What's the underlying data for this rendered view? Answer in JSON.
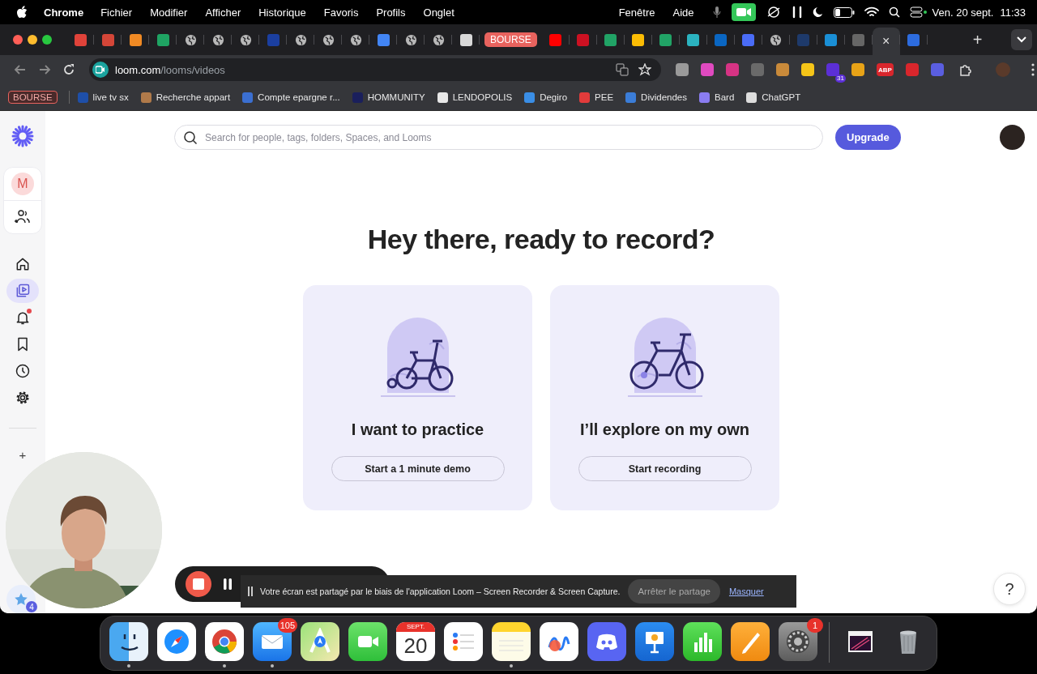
{
  "menu_bar": {
    "app": "Chrome",
    "menus": [
      "Fichier",
      "Modifier",
      "Afficher",
      "Historique",
      "Favoris",
      "Profils",
      "Onglet"
    ],
    "right_menus": [
      "Fenêtre",
      "Aide"
    ],
    "date": "Ven. 20 sept.",
    "time": "11:33"
  },
  "tabs": [
    {
      "kind": "favicon",
      "color": "#e0433a",
      "selected": false
    },
    {
      "kind": "favicon",
      "color": "#d44638",
      "selected": false
    },
    {
      "kind": "favicon",
      "color": "#f08a24",
      "selected": false
    },
    {
      "kind": "favicon",
      "color": "#1fa463",
      "selected": false
    },
    {
      "kind": "globe",
      "selected": false
    },
    {
      "kind": "globe",
      "selected": false
    },
    {
      "kind": "globe",
      "selected": false
    },
    {
      "kind": "favicon",
      "color": "#1b3fa0",
      "selected": false
    },
    {
      "kind": "globe",
      "selected": false
    },
    {
      "kind": "globe",
      "selected": false
    },
    {
      "kind": "globe",
      "selected": false
    },
    {
      "kind": "favicon",
      "color": "#4285f4",
      "selected": false
    },
    {
      "kind": "globe",
      "selected": false
    },
    {
      "kind": "globe",
      "selected": false
    },
    {
      "kind": "favicon",
      "color": "#d8d8d8",
      "selected": false
    },
    {
      "kind": "group",
      "label": "BOURSE"
    },
    {
      "kind": "favicon",
      "color": "#ff0000",
      "selected": false
    },
    {
      "kind": "favicon",
      "color": "#cc1122",
      "selected": false
    },
    {
      "kind": "favicon",
      "color": "#21a366",
      "selected": false
    },
    {
      "kind": "favicon",
      "color": "#fbbc04",
      "selected": false
    },
    {
      "kind": "favicon",
      "color": "#21a366",
      "selected": false
    },
    {
      "kind": "favicon",
      "color": "#2bb3c0",
      "selected": false
    },
    {
      "kind": "favicon",
      "color": "#0a66c2",
      "selected": false
    },
    {
      "kind": "favicon",
      "color": "#4a6cf7",
      "selected": false
    },
    {
      "kind": "globe",
      "selected": false
    },
    {
      "kind": "favicon",
      "color": "#1e3a6b",
      "selected": false
    },
    {
      "kind": "favicon",
      "color": "#1a8fd6",
      "selected": false
    },
    {
      "kind": "favicon",
      "color": "#666666",
      "selected": false
    },
    {
      "kind": "active",
      "close": "×",
      "selected": true
    },
    {
      "kind": "favicon",
      "color": "#2d6cdf",
      "selected": false
    }
  ],
  "new_tab": "+",
  "address_bar": {
    "host": "loom.com",
    "path": "/looms/videos"
  },
  "extensions": [
    {
      "color": "#9a9a9a"
    },
    {
      "color": "#e04ac0"
    },
    {
      "color": "#d63384"
    },
    {
      "color": "#6a6a6a"
    },
    {
      "color": "#c98a3a"
    },
    {
      "color": "#f5c518"
    },
    {
      "color": "#5b2fd6",
      "badge": "31"
    },
    {
      "color": "#e8a317"
    },
    {
      "color": "#d9262c",
      "label": "ABP"
    },
    {
      "color": "#d9262c"
    },
    {
      "color": "#5a5ee0"
    }
  ],
  "bookmarks": [
    {
      "kind": "group",
      "label": "BOURSE"
    },
    {
      "kind": "link",
      "label": "live tv sx",
      "color": "#1e4fa8"
    },
    {
      "kind": "link",
      "label": "Recherche appart",
      "color": "#b07a4a"
    },
    {
      "kind": "link",
      "label": "Compte epargne r...",
      "color": "#3b6fd1"
    },
    {
      "kind": "link",
      "label": "HOMMUNITY",
      "color": "#1a1f5c"
    },
    {
      "kind": "link",
      "label": "LENDOPOLIS",
      "color": "#e8e8e8"
    },
    {
      "kind": "link",
      "label": "Degiro",
      "color": "#3a8ee6"
    },
    {
      "kind": "link",
      "label": "PEE",
      "color": "#e23b3b"
    },
    {
      "kind": "link",
      "label": "Dividendes",
      "color": "#3b7dd8"
    },
    {
      "kind": "link",
      "label": "Bard",
      "color": "#8a7cf0"
    },
    {
      "kind": "link",
      "label": "ChatGPT",
      "color": "#dddddd"
    }
  ],
  "sidebar": {
    "workspace": "M",
    "items": [
      {
        "kind": "home",
        "selected": false
      },
      {
        "kind": "library",
        "selected": true
      },
      {
        "kind": "bell",
        "selected": false,
        "unread": true
      },
      {
        "kind": "bookmark",
        "selected": false
      },
      {
        "kind": "clock",
        "selected": false
      },
      {
        "kind": "gear",
        "selected": false
      }
    ],
    "add": "+"
  },
  "search": {
    "placeholder": "Search for people, tags, folders, Spaces, and Looms"
  },
  "upgrade": "Upgrade",
  "heading": "Hey there, ready to record?",
  "cards": [
    {
      "kind": "training",
      "title": "I want to practice",
      "button": "Start a 1 minute demo"
    },
    {
      "kind": "bike",
      "title": "I’ll explore on my own",
      "button": "Start recording"
    }
  ],
  "help": "?",
  "rewards_badge": "4",
  "share_banner": {
    "message": "Votre écran est partagé par le biais de l'application Loom – Screen Recorder & Screen Capture.",
    "stop": "Arrêter le partage",
    "hide": "Masquer"
  },
  "dock": [
    {
      "kind": "finder",
      "running": true
    },
    {
      "kind": "safari",
      "running": false
    },
    {
      "kind": "chrome",
      "running": true
    },
    {
      "kind": "mail",
      "running": true,
      "badge": "105"
    },
    {
      "kind": "maps",
      "running": false
    },
    {
      "kind": "facetime",
      "running": false
    },
    {
      "kind": "calendar",
      "running": false,
      "month": "SEPT.",
      "day": "20"
    },
    {
      "kind": "reminders",
      "running": false
    },
    {
      "kind": "notes",
      "running": true
    },
    {
      "kind": "freeform",
      "running": false
    },
    {
      "kind": "discord",
      "running": false
    },
    {
      "kind": "keynote",
      "running": false
    },
    {
      "kind": "numbers",
      "running": false
    },
    {
      "kind": "pages",
      "running": false
    },
    {
      "kind": "settings",
      "running": false,
      "badge": "1"
    },
    {
      "kind": "separator"
    },
    {
      "kind": "thumbnail",
      "running": false
    },
    {
      "kind": "trash",
      "running": false
    }
  ]
}
